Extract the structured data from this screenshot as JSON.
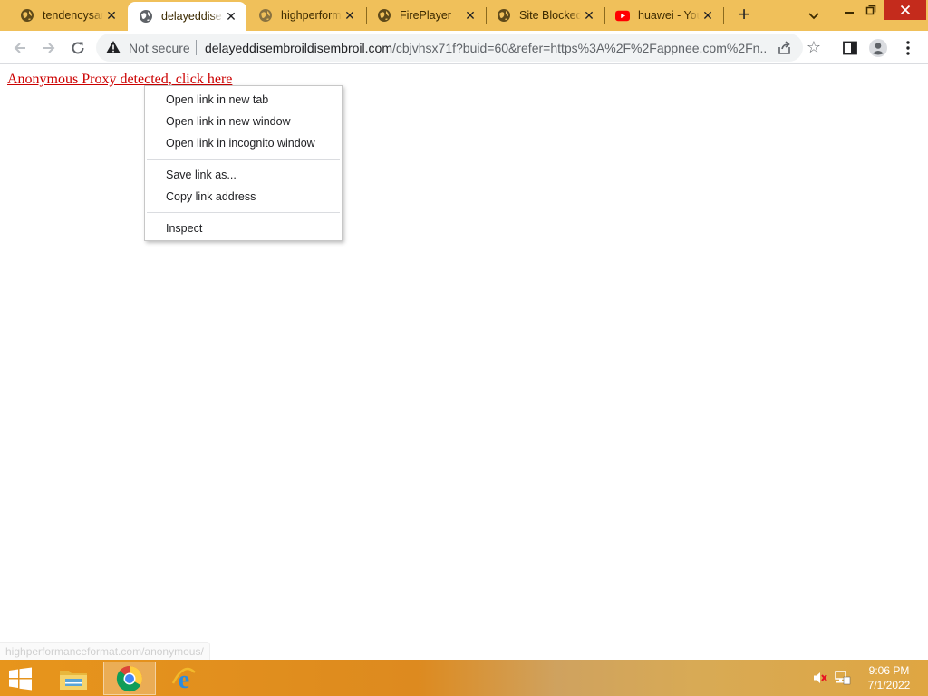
{
  "tabs": [
    {
      "title": "tendencysarcasm.com",
      "favicon": "globe-icon",
      "active": false
    },
    {
      "title": "delayeddisembroil",
      "favicon": "globe-icon",
      "active": true
    },
    {
      "title": "highperformanceformat",
      "favicon": "globe-icon",
      "active": false
    },
    {
      "title": "FirePlayer",
      "favicon": "globe-icon",
      "active": false
    },
    {
      "title": "Site Blocked",
      "favicon": "globe-icon",
      "active": false
    },
    {
      "title": "huawei - YouTube",
      "favicon": "youtube-icon",
      "active": false
    }
  ],
  "toolbar": {
    "security_label": "Not secure",
    "url_host": "delayeddisembroildisembroil.com",
    "url_path": "/cbjvhsx71f?buid=60&refer=https%3A%2F%2Fappnee.com%2Fn..."
  },
  "page": {
    "link_text": "Anonymous Proxy detected, click here"
  },
  "context_menu": {
    "group1": [
      "Open link in new tab",
      "Open link in new window",
      "Open link in incognito window"
    ],
    "group2": [
      "Save link as...",
      "Copy link address"
    ],
    "group3": [
      "Inspect"
    ]
  },
  "status_bar": {
    "url": "highperformanceformat.com/anonymous/"
  },
  "taskbar": {
    "apps": [
      "file-explorer-icon",
      "chrome-icon",
      "internet-explorer-icon"
    ],
    "time": "9:06 PM",
    "date": "7/1/2022"
  },
  "colors": {
    "tabstrip": "#f0c05a",
    "link": "#cc0000",
    "taskbar": "#e7951c"
  }
}
